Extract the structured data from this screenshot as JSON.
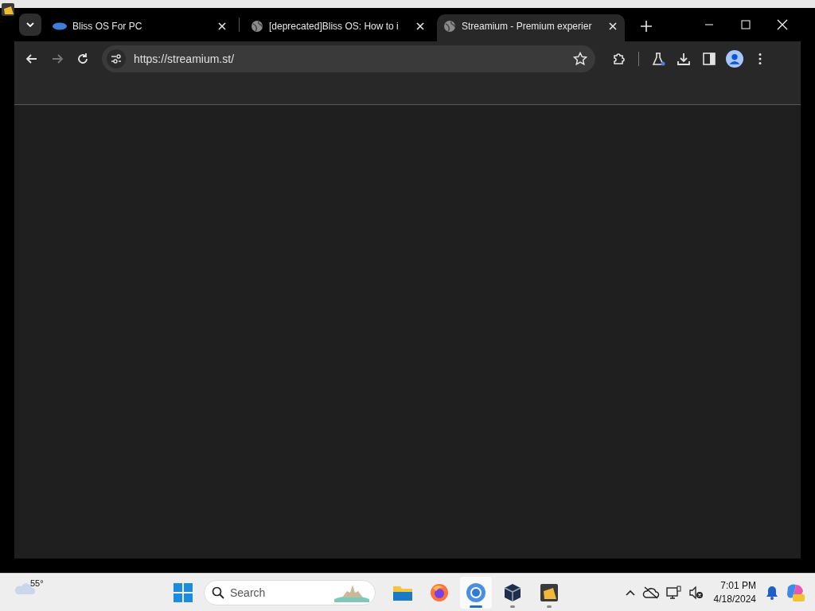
{
  "browser": {
    "tabs": [
      {
        "title": "Bliss OS For PC",
        "kind": "bliss",
        "selected": false
      },
      {
        "title": "[deprecated]Bliss OS: How to i",
        "kind": "globe",
        "selected": false
      },
      {
        "title": "Streamium - Premium experier",
        "kind": "globe",
        "selected": true
      }
    ],
    "address": "https://streamium.st/"
  },
  "taskbar": {
    "weather": "55°",
    "search": {
      "placeholder": "Search"
    },
    "apps": [
      {
        "kind": "files",
        "active": false,
        "running": false
      },
      {
        "kind": "firefox",
        "active": false,
        "running": false
      },
      {
        "kind": "chromium",
        "active": true,
        "running": true
      },
      {
        "kind": "virtualbox",
        "active": false,
        "running": true
      },
      {
        "kind": "blissapp",
        "active": false,
        "running": true
      }
    ],
    "time": "7:01 PM",
    "date": "4/18/2024"
  }
}
